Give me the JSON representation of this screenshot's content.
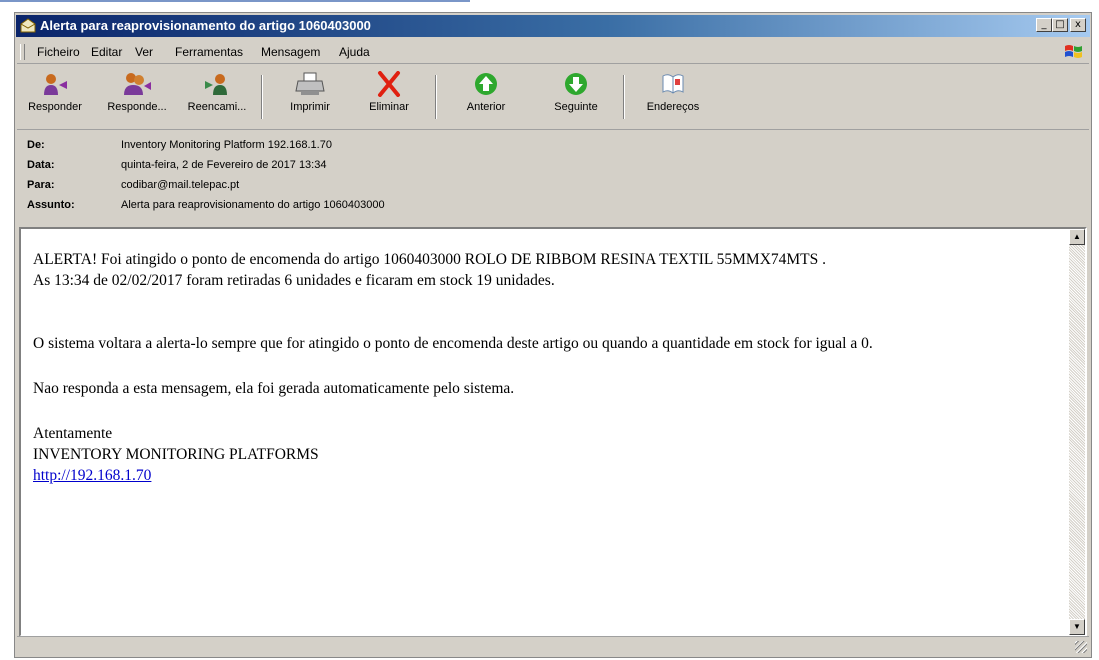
{
  "window": {
    "title": "Alerta para reaprovisionamento do artigo 1060403000",
    "controls": {
      "minimize": "_",
      "maximize": "□",
      "close": "x"
    }
  },
  "menu": [
    "Ficheiro",
    "Editar",
    "Ver",
    "Ferramentas",
    "Mensagem",
    "Ajuda"
  ],
  "toolbar": {
    "reply": "Responder",
    "reply_all": "Responde...",
    "forward": "Reencami...",
    "print": "Imprimir",
    "delete": "Eliminar",
    "previous": "Anterior",
    "next": "Seguinte",
    "addresses": "Endereços"
  },
  "headers": {
    "from_label": "De:",
    "from": "Inventory Monitoring Platform 192.168.1.70",
    "date_label": "Data:",
    "date": "quinta-feira, 2 de Fevereiro de 2017 13:34",
    "to_label": "Para:",
    "to": "codibar@mail.telepac.pt",
    "subject_label": "Assunto:",
    "subject": "Alerta para reaprovisionamento do artigo 1060403000"
  },
  "message": {
    "line1": "ALERTA! Foi atingido o ponto de encomenda do artigo 1060403000     ROLO DE RIBBOM RESINA TEXTIL 55MMX74MTS .",
    "line2": "As 13:34 de 02/02/2017 foram retiradas 6 unidades e ficaram em stock 19 unidades.",
    "line3": "O sistema voltara a alerta-lo sempre que for atingido o ponto de encomenda deste artigo ou quando a quantidade em stock for igual a 0.",
    "line4": "Nao responda a esta mensagem, ela foi gerada automaticamente pelo sistema.",
    "closing": "Atentamente",
    "signature": "INVENTORY MONITORING PLATFORMS",
    "link": "http://192.168.1.70"
  },
  "colors": {
    "titlebar_start": "#0a246a",
    "titlebar_end": "#a6caf0",
    "chrome": "#d4d0c8",
    "link": "#0000cc"
  }
}
